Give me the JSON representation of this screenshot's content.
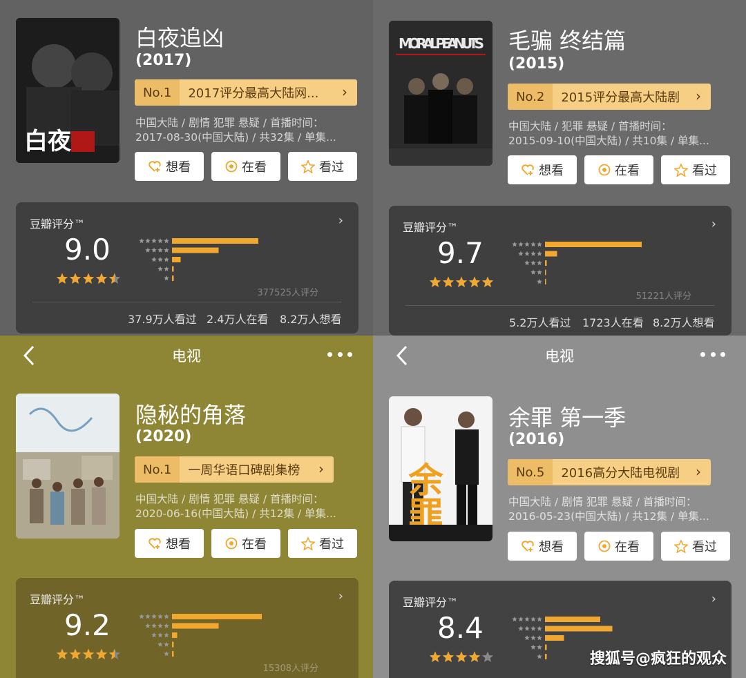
{
  "colors": {
    "rating_bar": "#f0a830",
    "star": "#f0a830",
    "rank_bg": "#f6cf84"
  },
  "cards": [
    {
      "title": "白夜追凶",
      "year": "(2017)",
      "rank_no": "No.1",
      "rank_text": "2017评分最高大陆网...",
      "meta_line1": "中国大陆 / 剧情 犯罪 悬疑 / 首播时间：",
      "meta_line2": "2017-08-30(中国大陆) / 共32集 / 单集...",
      "actions": [
        "想看",
        "在看",
        "看过"
      ],
      "rating_label": "豆瓣评分™",
      "score": "9.0",
      "stars_value": 4.5,
      "distribution": [
        0.5,
        0.27,
        0.05,
        0.01,
        0.01
      ],
      "rating_count": "377525人评分",
      "stats": [
        "37.9万人看过",
        "2.4万人在看",
        "8.2万人想看"
      ]
    },
    {
      "title": "毛骗 终结篇",
      "year": "(2015)",
      "poster_text": "MORAL PEANUTS",
      "rank_no": "No.2",
      "rank_text": "2015评分最高大陆剧",
      "meta_line1": "中国大陆 / 犯罪 悬疑 / 首播时间：",
      "meta_line2": "2015-09-10(中国大陆) / 共10集 / 单集...",
      "actions": [
        "想看",
        "在看",
        "看过"
      ],
      "rating_label": "豆瓣评分™",
      "score": "9.7",
      "stars_value": 5,
      "distribution": [
        0.74,
        0.07,
        0.01,
        0.005,
        0.005
      ],
      "rating_count": "51221人评分",
      "stats": [
        "5.2万人看过",
        "1723人在看",
        "8.2万人想看"
      ]
    },
    {
      "nav_title": "电视",
      "title": "隐秘的角落",
      "year": "(2020)",
      "rank_no": "No.1",
      "rank_text": "一周华语口碑剧集榜",
      "meta_line1": "中国大陆 / 剧情 犯罪 悬疑 / 首播时间：",
      "meta_line2": "2020-06-16(中国大陆) / 共12集 / 单集...",
      "actions": [
        "想看",
        "在看",
        "看过"
      ],
      "rating_label": "豆瓣评分™",
      "score": "9.2",
      "stars_value": 4.5,
      "distribution": [
        0.52,
        0.27,
        0.03,
        0.01,
        0.01
      ],
      "rating_count": "15308人评分"
    },
    {
      "nav_title": "电视",
      "title": "余罪 第一季",
      "year": "(2016)",
      "poster_text": "余罪",
      "rank_no": "No.5",
      "rank_text": "2016高分大陆电视剧",
      "meta_line1": "中国大陆 / 剧情 犯罪 悬疑 / 首播时间：",
      "meta_line2": "2016-05-23(中国大陆) / 共12集 / 单集...",
      "actions": [
        "想看",
        "在看",
        "看过"
      ],
      "rating_label": "豆瓣评分™",
      "score": "8.4",
      "stars_value": 4,
      "distribution": [
        0.32,
        0.39,
        0.11,
        0.01,
        0.01
      ]
    }
  ],
  "watermark": "搜狐号@疯狂的观众"
}
